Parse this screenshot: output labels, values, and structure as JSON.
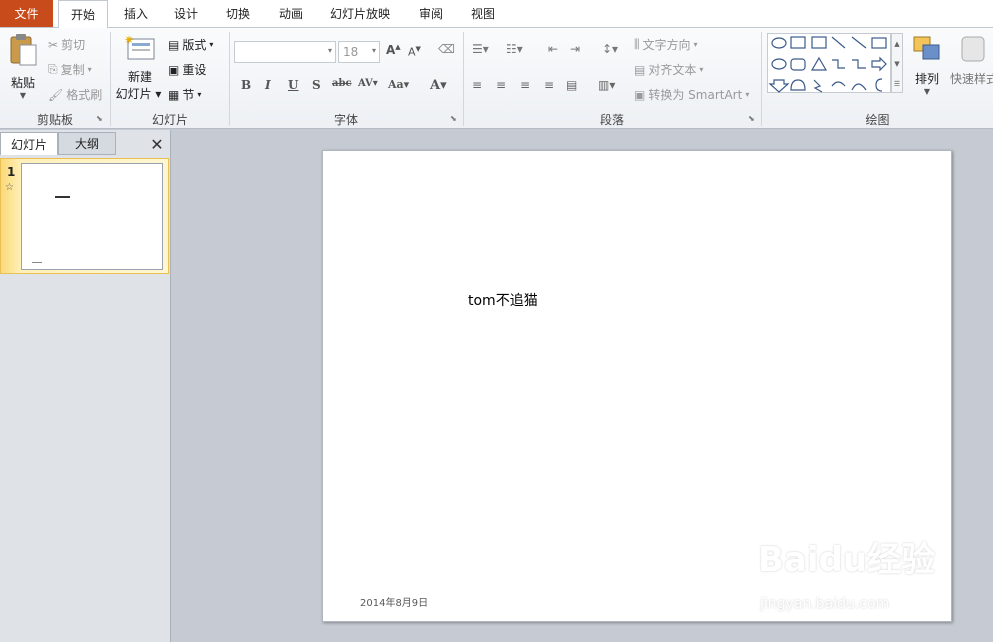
{
  "tabs": {
    "file": "文件",
    "home": "开始",
    "insert": "插入",
    "design": "设计",
    "transitions": "切换",
    "animations": "动画",
    "slideshow": "幻灯片放映",
    "review": "审阅",
    "view": "视图"
  },
  "clipboard": {
    "paste": "粘贴",
    "cut": "剪切",
    "copy": "复制",
    "format_painter": "格式刷",
    "label": "剪贴板"
  },
  "slides_group": {
    "new_slide_line1": "新建",
    "new_slide_line2": "幻灯片",
    "layout": "版式",
    "reset": "重设",
    "section": "节",
    "label": "幻灯片"
  },
  "font_group": {
    "font_name": "",
    "font_size": "18",
    "label": "字体"
  },
  "paragraph_group": {
    "text_direction": "文字方向",
    "align_text": "对齐文本",
    "convert_smartart": "转换为 SmartArt",
    "label": "段落"
  },
  "drawing_group": {
    "arrange": "排列",
    "quick_styles": "快速样式",
    "label": "绘图"
  },
  "panel": {
    "tab_slides": "幻灯片",
    "tab_outline": "大纲",
    "slide_number": "1"
  },
  "slide": {
    "text": "tom不追猫",
    "date": "2014年8月9日"
  },
  "watermark": {
    "line1": "Baidu经验",
    "line2": "jingyan.baidu.com"
  }
}
